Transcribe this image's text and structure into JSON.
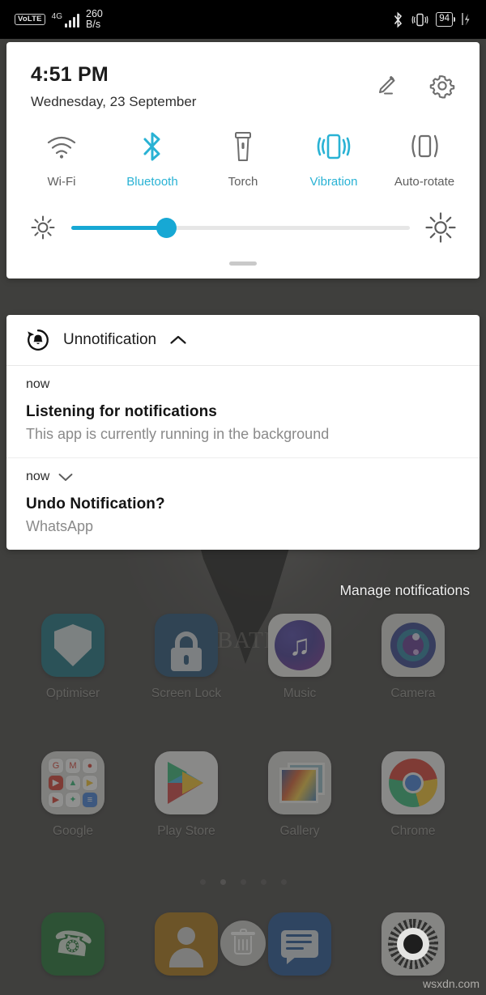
{
  "status_bar": {
    "volte_badge": "VoLTE",
    "network_type": "4G",
    "signal_bars": 4,
    "network_speed_value": "260",
    "network_speed_unit": "B/s",
    "bluetooth_icon": "bluetooth-icon",
    "vibrate_icon": "vibrate-icon",
    "battery_percent": "94",
    "charging_icon": "charging-bolt-icon"
  },
  "quick_settings": {
    "clock": "4:51 PM",
    "date": "Wednesday, 23 September",
    "edit_icon": "pencil-edit-icon",
    "settings_icon": "gear-icon",
    "toggles": [
      {
        "label": "Wi-Fi",
        "icon": "wifi-icon",
        "active": false
      },
      {
        "label": "Bluetooth",
        "icon": "bluetooth-icon",
        "active": true
      },
      {
        "label": "Torch",
        "icon": "flashlight-icon",
        "active": false
      },
      {
        "label": "Vibration",
        "icon": "vibrate-icon",
        "active": true
      },
      {
        "label": "Auto-rotate",
        "icon": "auto-rotate-icon",
        "active": false
      }
    ],
    "brightness": {
      "low_icon": "brightness-low-icon",
      "high_icon": "brightness-high-icon",
      "value_percent": 28
    },
    "drag_handle": "panel-drag-handle"
  },
  "notifications": {
    "group": {
      "app_icon": "undo-bell-icon",
      "app_name": "Unnotification",
      "collapse_icon": "chevron-up-icon"
    },
    "items": [
      {
        "time": "now",
        "title": "Listening for notifications",
        "text": "This app is currently running in the background",
        "expand_icon": null
      },
      {
        "time": "now",
        "title": "Undo Notification?",
        "text": "WhatsApp",
        "expand_icon": "chevron-down-icon"
      }
    ],
    "manage_label": "Manage notifications"
  },
  "home_screen": {
    "wallpaper_text": "BATM",
    "rows": [
      {
        "apps": [
          {
            "label": "Optimiser",
            "icon": "shield-icon"
          },
          {
            "label": "Screen Lock",
            "icon": "padlock-icon"
          },
          {
            "label": "Music",
            "icon": "music-note-icon"
          },
          {
            "label": "Camera",
            "icon": "camera-lens-icon"
          }
        ]
      },
      {
        "apps": [
          {
            "label": "Google",
            "icon": "google-folder-icon"
          },
          {
            "label": "Play Store",
            "icon": "play-store-icon"
          },
          {
            "label": "Gallery",
            "icon": "gallery-photos-icon"
          },
          {
            "label": "Chrome",
            "icon": "chrome-icon"
          }
        ]
      }
    ],
    "folder_mini_icons": [
      "G",
      "M",
      "●",
      "▶",
      "▲",
      "▶",
      "▶",
      "✦",
      "≡"
    ],
    "dock": [
      {
        "label": "",
        "icon": "phone-icon"
      },
      {
        "label": "",
        "icon": "contacts-icon"
      },
      {
        "label": "",
        "icon": "messaging-icon"
      },
      {
        "label": "",
        "icon": "settings-gear-icon"
      }
    ],
    "delete_target_icon": "trash-icon",
    "page_dots": 5,
    "active_page": 1
  },
  "watermark": "wsxdn.com",
  "colors": {
    "accent": "#29b2d4",
    "slider_fill": "#17a8d4",
    "panel_bg": "#ffffff",
    "dim_bg": "#403f3e",
    "status_bg": "#000000"
  }
}
